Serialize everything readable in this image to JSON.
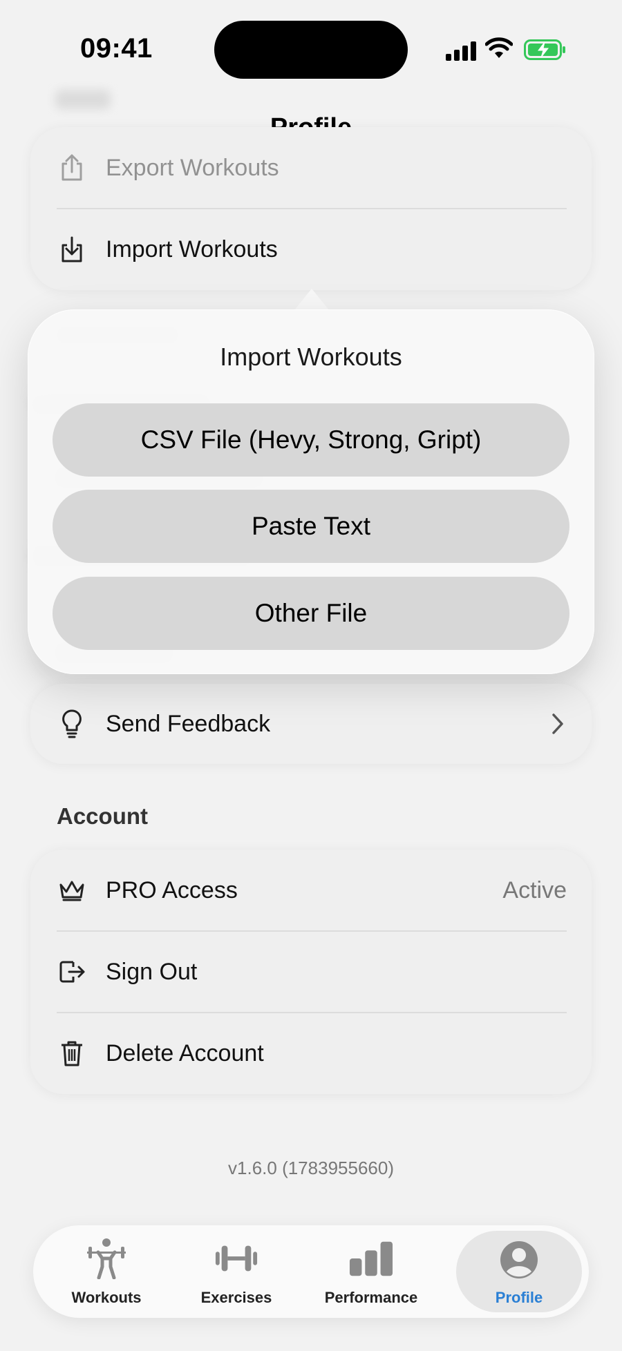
{
  "status_bar": {
    "time": "09:41"
  },
  "header": {
    "title": "Profile"
  },
  "data_section": {
    "items": [
      {
        "label": "Export Workouts",
        "icon": "share-icon"
      },
      {
        "label": "Import Workouts",
        "icon": "import-icon"
      }
    ]
  },
  "import_popover": {
    "title": "Import Workouts",
    "options": [
      {
        "label": "CSV File (Hevy, Strong, Gript)"
      },
      {
        "label": "Paste Text"
      },
      {
        "label": "Other File"
      }
    ]
  },
  "feedback": {
    "label": "Send Feedback",
    "icon": "lightbulb-icon"
  },
  "account": {
    "section_title": "Account",
    "items": [
      {
        "label": "PRO Access",
        "value": "Active",
        "icon": "crown-icon"
      },
      {
        "label": "Sign Out",
        "icon": "sign-out-icon"
      },
      {
        "label": "Delete Account",
        "icon": "trash-icon"
      }
    ]
  },
  "version": "v1.6.0 (1783955660)",
  "tab_bar": {
    "tabs": [
      {
        "label": "Workouts",
        "icon": "weightlifter-icon",
        "active": false
      },
      {
        "label": "Exercises",
        "icon": "dumbbell-icon",
        "active": false
      },
      {
        "label": "Performance",
        "icon": "bar-chart-icon",
        "active": false
      },
      {
        "label": "Profile",
        "icon": "person-circle-icon",
        "active": true
      }
    ]
  },
  "colors": {
    "accent": "#2a7fd4",
    "battery": "#34c759"
  }
}
